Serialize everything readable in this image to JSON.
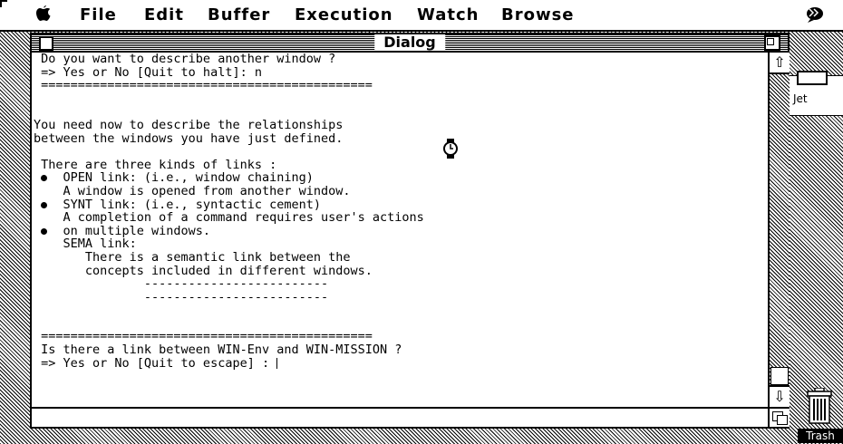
{
  "menubar": {
    "apple_symbol": "õ",
    "items": [
      "File",
      "Edit",
      "Buffer",
      "Execution",
      "Watch",
      "Browse"
    ],
    "right_icon": "balloon-help-icon"
  },
  "desktop": {
    "bg_window_label": "Jet",
    "trash_label": "Trash"
  },
  "dialog": {
    "title": "Dialog",
    "lines": [
      " Do you want to describe another window ?",
      " => Yes or No [Quit to halt]: n",
      " =============================================",
      "",
      "",
      "You need now to describe the relationships",
      "between the windows you have just defined.",
      "",
      " There are three kinds of links :",
      "    OPEN link: (i.e., window chaining)",
      "    A window is opened from another window.",
      "    SYNT link: (i.e., syntactic cement)",
      "    A completion of a command requires user's actions",
      "    on multiple windows.",
      "    SEMA link:",
      "       There is a semantic link between the",
      "       concepts included in different windows.",
      "               -------------------------",
      "               -------------------------",
      "",
      "",
      " =============================================",
      " Is there a link between WIN-Env and WIN-MISSION ?",
      " => Yes or No [Quit to escape] : "
    ],
    "bullet_lines": [
      9,
      11,
      13
    ]
  },
  "colors": {
    "foreground": "#000000",
    "background": "#ffffff"
  }
}
